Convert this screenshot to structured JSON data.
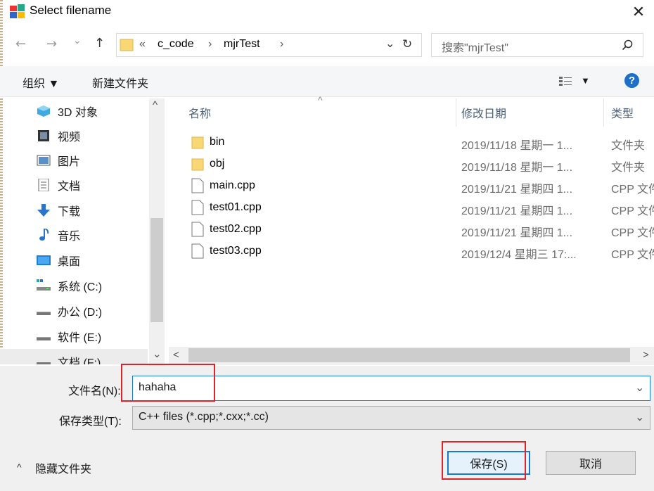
{
  "window": {
    "title": "Select filename",
    "close_glyph": "✕"
  },
  "nav_buttons": {
    "back": "←",
    "forward": "→",
    "dropdown": "⌄",
    "up": "↑",
    "refresh": "↻"
  },
  "address": {
    "overflow": "«",
    "crumbs": [
      "c_code",
      "mjrTest"
    ],
    "sep": "›"
  },
  "search": {
    "placeholder": "搜索\"mjrTest\""
  },
  "toolbar": {
    "organize": "组织 ▼",
    "new_folder": "新建文件夹",
    "view_arrow": "▼",
    "help": "?"
  },
  "nav_pane": {
    "items": [
      {
        "label": "3D 对象",
        "icon": "cube-3d-icon"
      },
      {
        "label": "视频",
        "icon": "video-icon"
      },
      {
        "label": "图片",
        "icon": "pictures-icon"
      },
      {
        "label": "文档",
        "icon": "documents-icon"
      },
      {
        "label": "下载",
        "icon": "download-icon"
      },
      {
        "label": "音乐",
        "icon": "music-icon"
      },
      {
        "label": "桌面",
        "icon": "desktop-icon"
      },
      {
        "label": "系统 (C:)",
        "icon": "drive-system-icon"
      },
      {
        "label": "办公 (D:)",
        "icon": "drive-icon"
      },
      {
        "label": "软件 (E:)",
        "icon": "drive-icon"
      },
      {
        "label": "文档 (F:)",
        "icon": "drive-icon"
      }
    ]
  },
  "columns": {
    "name": "名称",
    "date": "修改日期",
    "type": "类型",
    "sort_glyph": "^"
  },
  "files": [
    {
      "name": "bin",
      "date": "2019/11/18 星期一 1...",
      "type": "文件夹",
      "kind": "folder"
    },
    {
      "name": "obj",
      "date": "2019/11/18 星期一 1...",
      "type": "文件夹",
      "kind": "folder"
    },
    {
      "name": "main.cpp",
      "date": "2019/11/21 星期四 1...",
      "type": "CPP 文件",
      "kind": "file"
    },
    {
      "name": "test01.cpp",
      "date": "2019/11/21 星期四 1...",
      "type": "CPP 文件",
      "kind": "file"
    },
    {
      "name": "test02.cpp",
      "date": "2019/11/21 星期四 1...",
      "type": "CPP 文件",
      "kind": "file"
    },
    {
      "name": "test03.cpp",
      "date": "2019/12/4 星期三 17:...",
      "type": "CPP 文件",
      "kind": "file"
    }
  ],
  "scroll_glyphs": {
    "up": "^",
    "down": "⌄",
    "left": "<",
    "right": ">"
  },
  "form": {
    "filename_label": "文件名(N):",
    "filename_value": "hahaha",
    "filetype_label": "保存类型(T):",
    "filetype_value": "C++ files (*.cpp;*.cxx;*.cc)",
    "dropdown_glyph": "⌄"
  },
  "footer": {
    "hide_folders": "隐藏文件夹",
    "hide_glyph": "^",
    "save": "保存(S)",
    "cancel": "取消"
  },
  "colors": {
    "accent": "#1679d4",
    "highlight_red": "#e0232a",
    "folder": "#f8d775"
  }
}
